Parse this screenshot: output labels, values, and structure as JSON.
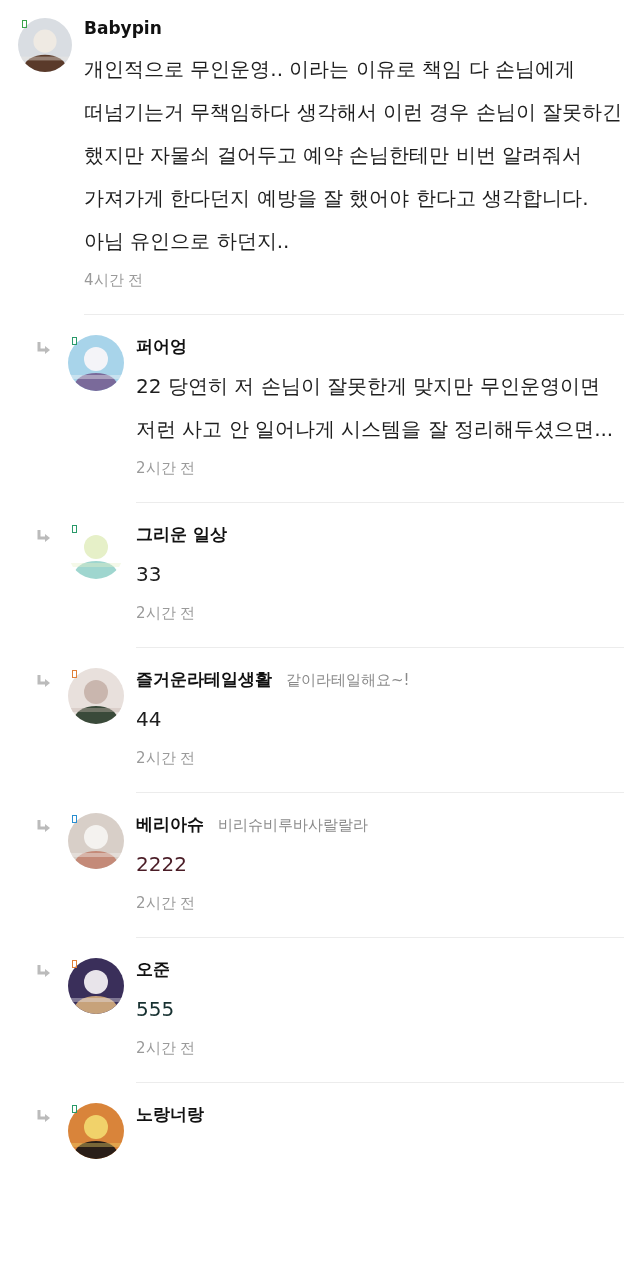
{
  "comment": {
    "author": "Babypin",
    "body": "개인적으로 무인운영.. 이라는 이유로 책임 다 손님에게 떠넘기는거 무책임하다 생각해서 이런 경우 손님이 잘못하긴 했지만 자물쇠 걸어두고 예약 손님한테만 비번 알려줘서 가져가게 한다던지 예방을 잘 했어야 한다고 생각합니다. 아님 유인으로 하던지..",
    "time": "4시간 전",
    "color": "#1e1e1e",
    "replies": [
      {
        "author": "퍼어엉",
        "body": "22 당연히 저 손님이 잘못한게 맞지만 무인운영이면 저런 사고 안 일어나게 시스템을 잘 정리해두셨으면...",
        "time": "2시간 전",
        "color": "#1e1e1e"
      },
      {
        "author": "그리운 일상",
        "body": "33",
        "time": "2시간 전",
        "color": "#1e1e1e"
      },
      {
        "author": "즐거운라테일생활",
        "status": "같이라테일해요~!",
        "body": "44",
        "time": "2시간 전",
        "color": "#1e1e1e"
      },
      {
        "author": "베리아슈",
        "status": "비리슈비루바사랄랄라",
        "body": "2222",
        "time": "2시간 전",
        "color": "#4a1c26"
      },
      {
        "author": "오준",
        "body": "555",
        "time": "2시간 전",
        "color": "#163030"
      },
      {
        "author": "노랑너랑"
      }
    ]
  }
}
